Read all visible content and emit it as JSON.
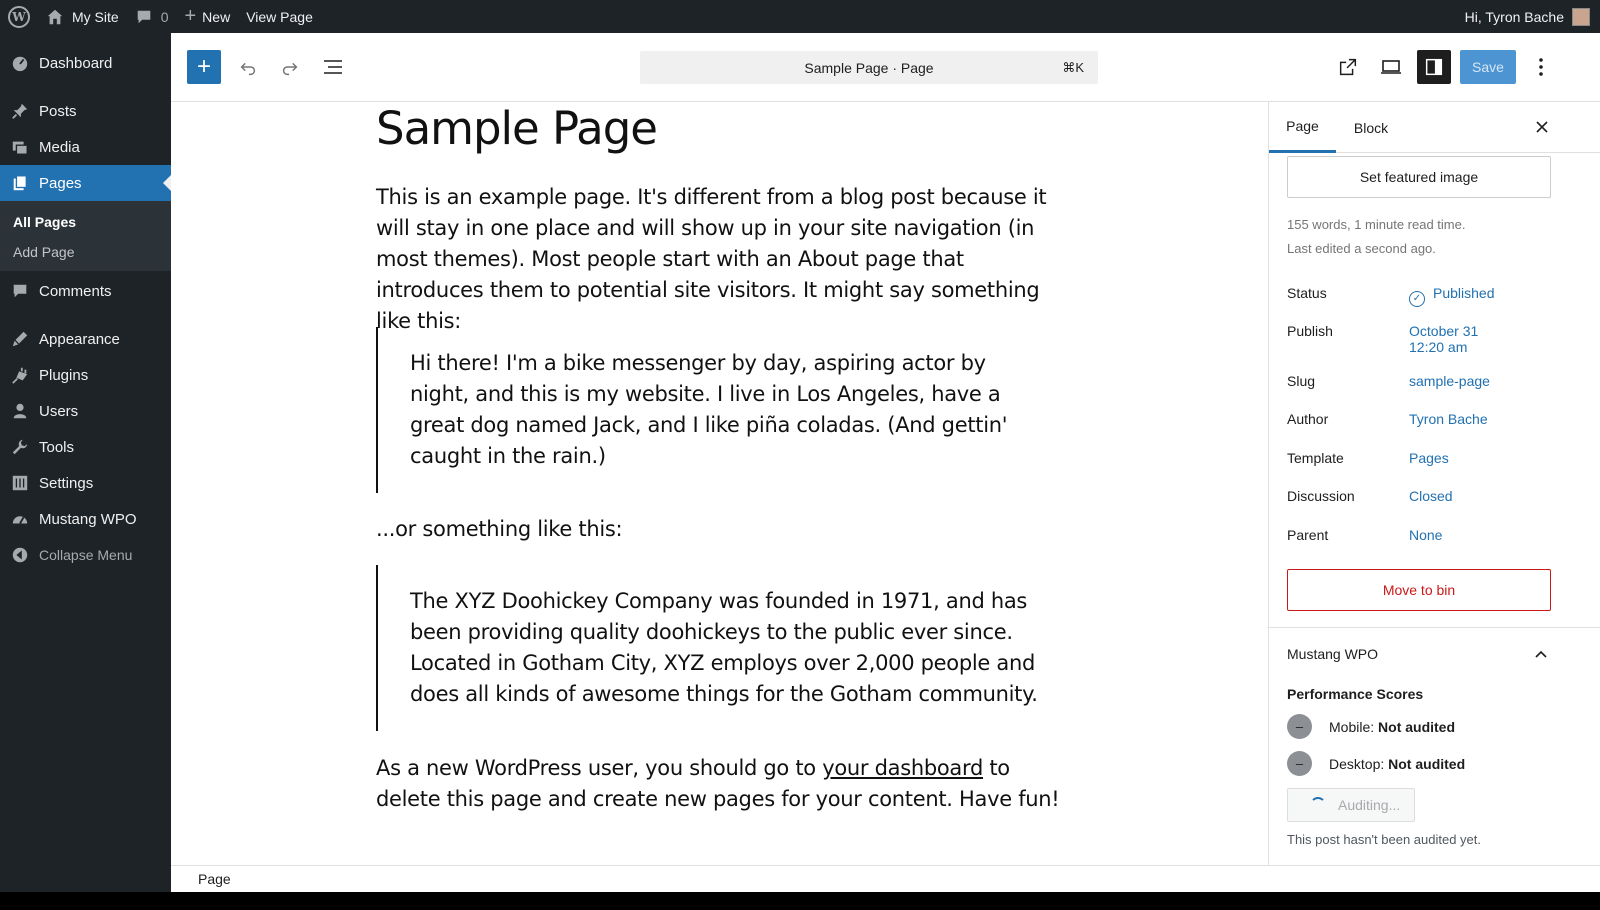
{
  "adminbar": {
    "site_name": "My Site",
    "comments_count": "0",
    "new_label": "New",
    "view_page_label": "View Page",
    "greeting": "Hi, Tyron Bache"
  },
  "sidebar": {
    "items": [
      {
        "label": "Dashboard",
        "icon": "dashboard-icon"
      },
      {
        "label": "Posts",
        "icon": "pin-icon"
      },
      {
        "label": "Media",
        "icon": "media-icon"
      },
      {
        "label": "Pages",
        "icon": "pages-icon"
      },
      {
        "label": "Comments",
        "icon": "comment-icon"
      },
      {
        "label": "Appearance",
        "icon": "brush-icon"
      },
      {
        "label": "Plugins",
        "icon": "plug-icon"
      },
      {
        "label": "Users",
        "icon": "user-icon"
      },
      {
        "label": "Tools",
        "icon": "wrench-icon"
      },
      {
        "label": "Settings",
        "icon": "settings-icon"
      },
      {
        "label": "Mustang WPO",
        "icon": "gauge-icon"
      }
    ],
    "submenu": [
      "All Pages",
      "Add Page"
    ],
    "collapse_label": "Collapse Menu"
  },
  "header": {
    "command_title": "Sample Page · Page",
    "shortcut": "⌘K",
    "save_label": "Save"
  },
  "content": {
    "title": "Sample Page",
    "p1": "This is an example page. It's different from a blog post because it will stay in one place and will show up in your site navigation (in most themes). Most people start with an About page that introduces them to potential site visitors. It might say something like this:",
    "quote1": "Hi there! I'm a bike messenger by day, aspiring actor by night, and this is my website. I live in Los Angeles, have a great dog named Jack, and I like piña coladas. (And gettin' caught in the rain.)",
    "p2": "...or something like this:",
    "quote2": "The XYZ Doohickey Company was founded in 1971, and has been providing quality doohickeys to the public ever since. Located in Gotham City, XYZ employs over 2,000 people and does all kinds of awesome things for the Gotham community.",
    "p3_before": "As a new WordPress user, you should go to ",
    "p3_link": "your dashboard",
    "p3_after": " to delete this page and create new pages for your content. Have fun!"
  },
  "settings": {
    "tab_page": "Page",
    "tab_block": "Block",
    "featured_image_label": "Set featured image",
    "word_count": "155 words, 1 minute read time.",
    "last_edited": "Last edited a second ago.",
    "rows": [
      {
        "label": "Status",
        "value": "Published"
      },
      {
        "label": "Publish",
        "value": "October 31",
        "value2": "12:20 am"
      },
      {
        "label": "Slug",
        "value": "sample-page"
      },
      {
        "label": "Author",
        "value": "Tyron Bache"
      },
      {
        "label": "Template",
        "value": "Pages"
      },
      {
        "label": "Discussion",
        "value": "Closed"
      },
      {
        "label": "Parent",
        "value": "None"
      }
    ],
    "bin_label": "Move to bin",
    "wpo": {
      "title": "Mustang WPO",
      "heading": "Performance Scores",
      "mobile_label": "Mobile:",
      "mobile_value": "Not audited",
      "desktop_label": "Desktop:",
      "desktop_value": "Not audited",
      "dot_symbol": "–",
      "auditing_label": "Auditing...",
      "note": "This post hasn't been audited yet."
    }
  },
  "footer": {
    "breadcrumb": "Page"
  },
  "colors": {
    "accent": "#2271b1",
    "admin_dark": "#1d2327",
    "danger": "#cc1818"
  }
}
